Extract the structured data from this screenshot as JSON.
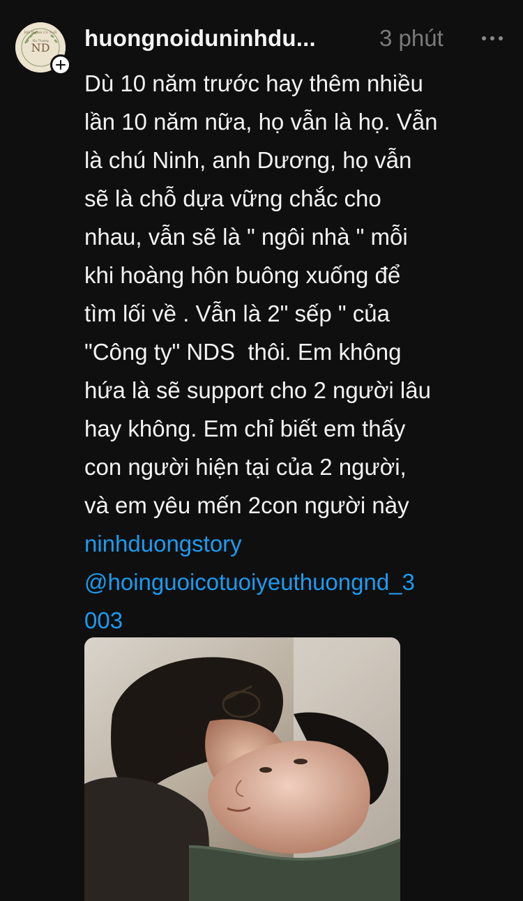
{
  "post": {
    "username": "huongnoiduninhdu...",
    "timestamp": "3 phút",
    "avatar_text": {
      "ring": "Hội Người Có Tuổi",
      "sub": "Yêu Thương",
      "initials": "ND"
    },
    "lines": [
      "Dù 10 năm trước hay thêm nhiều",
      "lần 10 năm nữa, họ vẫn là họ. Vẫn",
      "là chú Ninh, anh Dương, họ vẫn",
      "sẽ là chỗ dựa vững chắc cho",
      "nhau, vẫn sẽ là \" ngôi nhà \" mỗi",
      "khi hoàng hôn buông xuống để",
      "tìm lối về . Vẫn là 2\" sếp \" của",
      "\"Công ty\" NDS  thôi. Em không",
      "hứa là sẽ support cho 2 người lâu",
      "hay không. Em chỉ biết em thấy",
      "con người hiện tại của 2 người,",
      "và em yêu mến 2con người này"
    ],
    "links": [
      "ninhduongstory",
      "@hoinguoicotuoiyeuthuongnd_3",
      "003"
    ]
  },
  "icons": {
    "follow": "plus-icon",
    "more": "more-horizontal-icon"
  },
  "colors": {
    "background": "#0f0f0f",
    "text": "#f3f3f3",
    "muted": "#7a7a7a",
    "link": "#1d9bf0"
  }
}
